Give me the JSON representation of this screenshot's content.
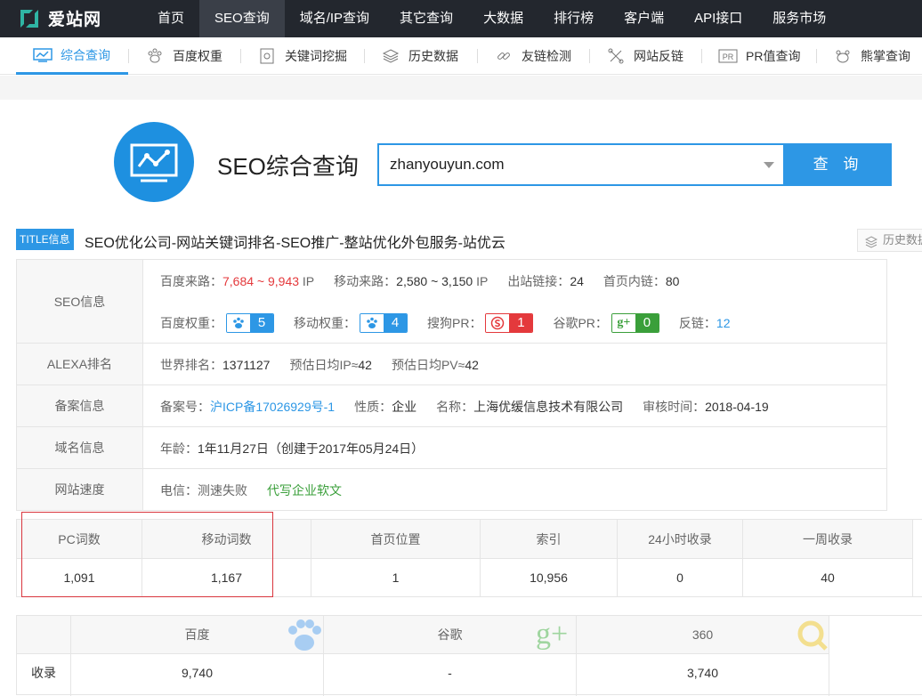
{
  "brand": {
    "name": "爱站网"
  },
  "topnav": [
    "首页",
    "SEO查询",
    "域名/IP查询",
    "其它查询",
    "大数据",
    "排行榜",
    "客户端",
    "API接口",
    "服务市场"
  ],
  "topnav_active": "SEO查询",
  "subnav": [
    "综合查询",
    "百度权重",
    "关键词挖掘",
    "历史数据",
    "友链检测",
    "网站反链",
    "PR值查询",
    "熊掌查询"
  ],
  "subnav_active": "综合查询",
  "search": {
    "title": "SEO综合查询",
    "value": "zhanyouyun.com",
    "button": "查 询"
  },
  "title_info": {
    "badge": "TITLE信息",
    "text": "SEO优化公司-网站关键词排名-SEO推广-整站优化外包服务-站优云",
    "history_button": "历史数据"
  },
  "seo_info": {
    "label": "SEO信息",
    "baidu_traffic_label": "百度来路：",
    "baidu_traffic": "7,684 ~ 9,943",
    "ip_unit": "IP",
    "mobile_traffic_label": "移动来路：",
    "mobile_traffic": "2,580 ~ 3,150",
    "out_links_label": "出站链接：",
    "out_links": "24",
    "home_links_label": "首页内链：",
    "home_links": "80",
    "baidu_weight_label": "百度权重：",
    "baidu_weight": "5",
    "mobile_weight_label": "移动权重：",
    "mobile_weight": "4",
    "sogou_pr_label": "搜狗PR：",
    "sogou_pr": "1",
    "google_pr_label": "谷歌PR：",
    "google_pr": "0",
    "backlinks_label": "反链：",
    "backlinks": "12"
  },
  "alexa": {
    "label": "ALEXA排名",
    "world_rank_label": "世界排名：",
    "world_rank": "1371127",
    "ip_label": "预估日均IP≈",
    "ip": "42",
    "pv_label": "预估日均PV≈",
    "pv": "42"
  },
  "beian": {
    "label": "备案信息",
    "no_label": "备案号：",
    "no": "沪ICP备17026929号-1",
    "type_label": "性质：",
    "type": "企业",
    "name_label": "名称：",
    "name": "上海优缓信息技术有限公司",
    "audit_label": "审核时间：",
    "audit": "2018-04-19"
  },
  "domain": {
    "label": "域名信息",
    "age_label": "年龄：",
    "age": "1年11月27日（创建于2017年05月24日）"
  },
  "speed": {
    "label": "网站速度",
    "telecom": "电信：测速失败",
    "ad": "代写企业软文"
  },
  "stats": {
    "headers": [
      "PC词数",
      "移动词数",
      "首页位置",
      "索引",
      "24小时收录",
      "一周收录"
    ],
    "values": [
      "1,091",
      "1,167",
      "1",
      "10,956",
      "0",
      "40"
    ]
  },
  "engines": {
    "row_label": "收录",
    "headers": [
      "百度",
      "谷歌",
      "360"
    ],
    "values": [
      "9,740",
      "-",
      "3,740"
    ]
  },
  "colors": {
    "accent": "#2d97e5",
    "topbar": "#23272e",
    "red": "#e4393c",
    "green": "#3a9f3a",
    "highlight_box": "#d9363e"
  }
}
